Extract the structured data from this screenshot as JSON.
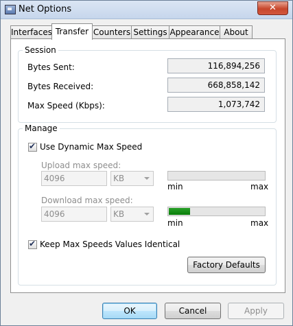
{
  "window": {
    "title": "Net Options",
    "close_label": "✕"
  },
  "tabs": [
    {
      "label": "Interfaces",
      "active": false
    },
    {
      "label": "Transfer",
      "active": true
    },
    {
      "label": "Counters",
      "active": false
    },
    {
      "label": "Settings",
      "active": false
    },
    {
      "label": "Appearance",
      "active": false
    },
    {
      "label": "About",
      "active": false
    }
  ],
  "session": {
    "title": "Session",
    "rows": [
      {
        "label": "Bytes Sent:",
        "value": "116,894,256"
      },
      {
        "label": "Bytes Received:",
        "value": "668,858,142"
      },
      {
        "label": "Max Speed (Kbps):",
        "value": "1,073,742"
      }
    ]
  },
  "manage": {
    "title": "Manage",
    "dynamic_label": "Use Dynamic Max Speed",
    "dynamic_checked": true,
    "upload": {
      "label": "Upload max speed:",
      "value": "4096",
      "unit": "KB",
      "min": "min",
      "max": "max",
      "level": 0.0
    },
    "download": {
      "label": "Download max speed:",
      "value": "4096",
      "unit": "KB",
      "min": "min",
      "max": "max",
      "level": 0.22
    },
    "identical_label": "Keep Max Speeds Values Identical",
    "identical_checked": true,
    "factory_label": "Factory Defaults"
  },
  "buttons": {
    "ok": "OK",
    "cancel": "Cancel",
    "apply": "Apply"
  },
  "colors": {
    "progress": "#128a12",
    "titlebar": "#c6d6ec"
  }
}
